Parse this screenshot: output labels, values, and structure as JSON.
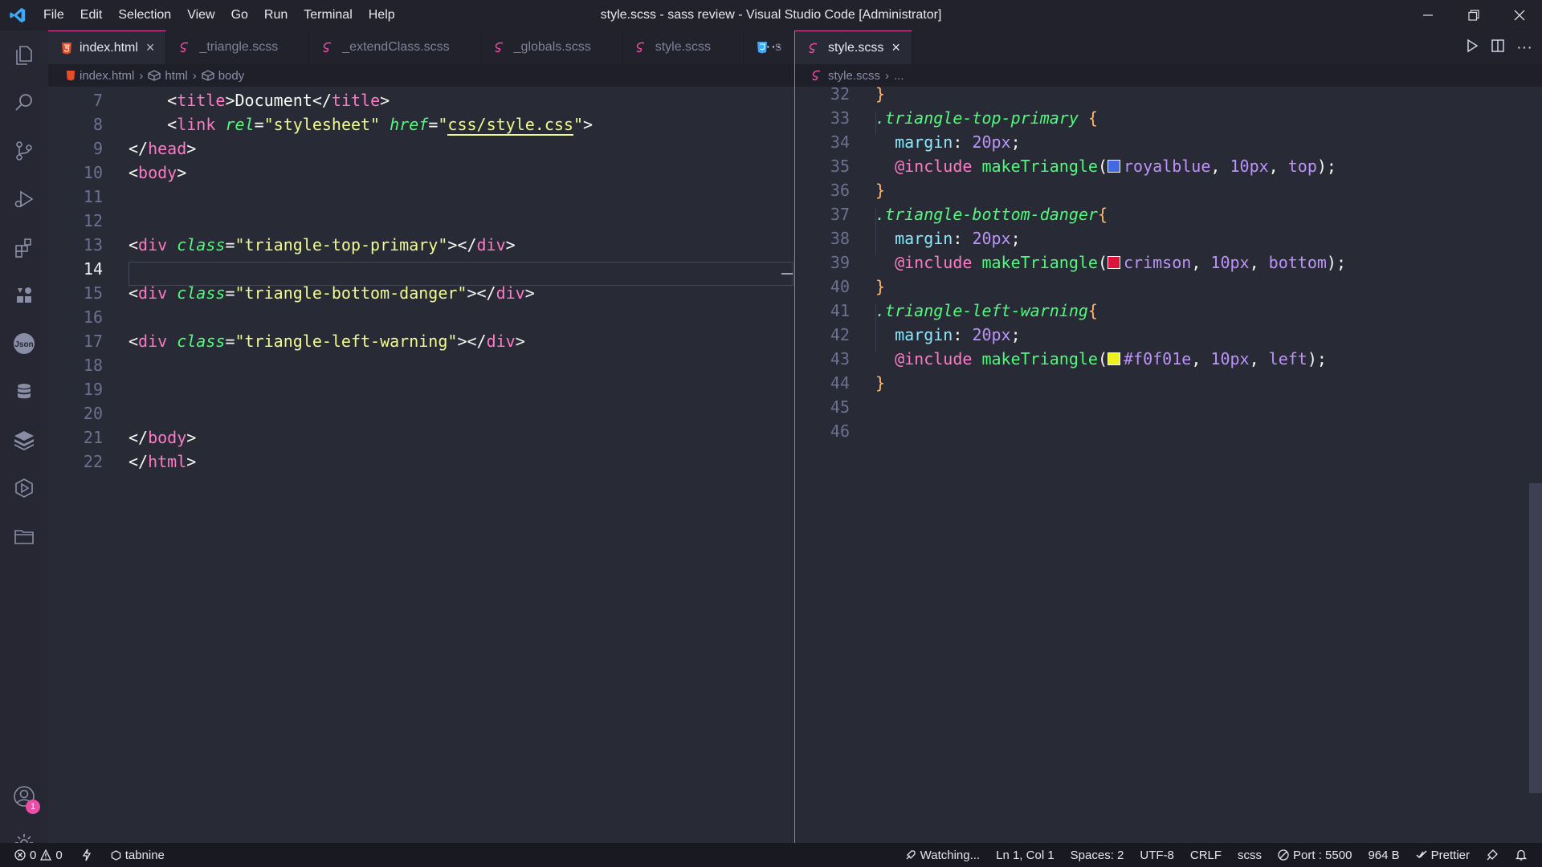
{
  "window": {
    "title": "style.scss - sass review - Visual Studio Code [Administrator]",
    "menu": [
      "File",
      "Edit",
      "Selection",
      "View",
      "Go",
      "Run",
      "Terminal",
      "Help"
    ]
  },
  "colors": {
    "accent": "#e84fa4",
    "background": "#282a36",
    "statusbar": "#191a21"
  },
  "activity_bar": {
    "icons": [
      "explorer-icon",
      "search-icon",
      "source-control-icon",
      "run-debug-icon",
      "extensions-icon",
      "puzzle-icon",
      "json-icon",
      "database-icon",
      "layers-icon",
      "play-outline-icon",
      "folder-icon",
      "account-icon",
      "settings-gear-icon"
    ],
    "account_badge": "1"
  },
  "left_group": {
    "tabs": [
      {
        "label": "index.html",
        "icon": "html-file-icon",
        "active": true
      },
      {
        "label": "_triangle.scss",
        "icon": "sass-file-icon"
      },
      {
        "label": "_extendClass.scss",
        "icon": "sass-file-icon"
      },
      {
        "label": "_globals.scss",
        "icon": "sass-file-icon"
      },
      {
        "label": "style.scss",
        "icon": "sass-file-icon"
      },
      {
        "label": "s",
        "icon": "css-file-icon"
      }
    ],
    "more": "···",
    "breadcrumb": [
      "index.html",
      "html",
      "body"
    ],
    "lines": [
      {
        "n": "7",
        "tokens": [
          [
            "t-punc",
            "    <"
          ],
          [
            "t-tag",
            "title"
          ],
          [
            "t-punc",
            ">"
          ],
          [
            "t-txt",
            "Document"
          ],
          [
            "t-punc",
            "</"
          ],
          [
            "t-tag",
            "title"
          ],
          [
            "t-punc",
            ">"
          ]
        ]
      },
      {
        "n": "8",
        "tokens": [
          [
            "t-punc",
            "    <"
          ],
          [
            "t-tag",
            "link"
          ],
          [
            "t-txt",
            " "
          ],
          [
            "t-attr",
            "rel"
          ],
          [
            "t-punc",
            "="
          ],
          [
            "t-str",
            "\"stylesheet\""
          ],
          [
            "t-txt",
            " "
          ],
          [
            "t-attr",
            "href"
          ],
          [
            "t-punc",
            "="
          ],
          [
            "t-str",
            "\""
          ],
          [
            "t-str link-u",
            "css/style.css"
          ],
          [
            "t-str",
            "\""
          ],
          [
            "t-punc",
            ">"
          ]
        ]
      },
      {
        "n": "9",
        "tokens": [
          [
            "t-punc",
            "</"
          ],
          [
            "t-tag",
            "head"
          ],
          [
            "t-punc",
            ">"
          ]
        ]
      },
      {
        "n": "10",
        "tokens": [
          [
            "t-punc",
            "<"
          ],
          [
            "t-tag",
            "body"
          ],
          [
            "t-punc",
            ">"
          ]
        ]
      },
      {
        "n": "11",
        "tokens": []
      },
      {
        "n": "12",
        "tokens": []
      },
      {
        "n": "13",
        "tokens": [
          [
            "t-punc",
            "<"
          ],
          [
            "t-tag",
            "div"
          ],
          [
            "t-txt",
            " "
          ],
          [
            "t-attr",
            "class"
          ],
          [
            "t-punc",
            "="
          ],
          [
            "t-str",
            "\"triangle-top-primary\""
          ],
          [
            "t-punc",
            "></"
          ],
          [
            "t-tag",
            "div"
          ],
          [
            "t-punc",
            ">"
          ]
        ]
      },
      {
        "n": "14",
        "tokens": [],
        "current": true
      },
      {
        "n": "15",
        "tokens": [
          [
            "t-punc",
            "<"
          ],
          [
            "t-tag",
            "div"
          ],
          [
            "t-txt",
            " "
          ],
          [
            "t-attr",
            "class"
          ],
          [
            "t-punc",
            "="
          ],
          [
            "t-str",
            "\"triangle-bottom-danger\""
          ],
          [
            "t-punc",
            "></"
          ],
          [
            "t-tag",
            "div"
          ],
          [
            "t-punc",
            ">"
          ]
        ]
      },
      {
        "n": "16",
        "tokens": []
      },
      {
        "n": "17",
        "tokens": [
          [
            "t-punc",
            "<"
          ],
          [
            "t-tag",
            "div"
          ],
          [
            "t-txt",
            " "
          ],
          [
            "t-attr",
            "class"
          ],
          [
            "t-punc",
            "="
          ],
          [
            "t-str",
            "\"triangle-left-warning\""
          ],
          [
            "t-punc",
            "></"
          ],
          [
            "t-tag",
            "div"
          ],
          [
            "t-punc",
            ">"
          ]
        ]
      },
      {
        "n": "18",
        "tokens": []
      },
      {
        "n": "19",
        "tokens": []
      },
      {
        "n": "20",
        "tokens": []
      },
      {
        "n": "21",
        "tokens": [
          [
            "t-punc",
            "</"
          ],
          [
            "t-tag",
            "body"
          ],
          [
            "t-punc",
            ">"
          ]
        ]
      },
      {
        "n": "22",
        "tokens": [
          [
            "t-punc",
            "</"
          ],
          [
            "t-tag",
            "html"
          ],
          [
            "t-punc",
            ">"
          ]
        ]
      }
    ]
  },
  "right_group": {
    "tab": {
      "label": "style.scss",
      "icon": "sass-file-icon",
      "close": "×"
    },
    "breadcrumb": [
      "style.scss",
      "..."
    ],
    "lines": [
      {
        "n": "32",
        "tokens": [
          [
            "t-brace",
            "}"
          ]
        ]
      },
      {
        "n": "33",
        "tokens": [
          [
            "t-sel",
            ".triangle-top-primary"
          ],
          [
            "t-txt",
            " "
          ],
          [
            "t-brace",
            "{"
          ]
        ]
      },
      {
        "n": "34",
        "tokens": [
          [
            "t-txt",
            "  "
          ],
          [
            "t-prop",
            "margin"
          ],
          [
            "t-txt",
            ": "
          ],
          [
            "t-num",
            "20px"
          ],
          [
            "t-txt",
            ";"
          ]
        ]
      },
      {
        "n": "35",
        "tokens": [
          [
            "t-txt",
            "  "
          ],
          [
            "t-kw",
            "@include"
          ],
          [
            "t-txt",
            " "
          ],
          [
            "t-fn",
            "makeTriangle"
          ],
          [
            "t-txt",
            "("
          ],
          [
            "swatch",
            "#4169e1"
          ],
          [
            "t-val",
            "royalblue"
          ],
          [
            "t-txt",
            ", "
          ],
          [
            "t-num",
            "10px"
          ],
          [
            "t-txt",
            ", "
          ],
          [
            "t-val",
            "top"
          ],
          [
            "t-txt",
            ");"
          ]
        ]
      },
      {
        "n": "36",
        "tokens": [
          [
            "t-brace",
            "}"
          ]
        ]
      },
      {
        "n": "37",
        "tokens": [
          [
            "t-sel",
            ".triangle-bottom-danger"
          ],
          [
            "t-brace",
            "{"
          ]
        ]
      },
      {
        "n": "38",
        "tokens": [
          [
            "t-txt",
            "  "
          ],
          [
            "t-prop",
            "margin"
          ],
          [
            "t-txt",
            ": "
          ],
          [
            "t-num",
            "20px"
          ],
          [
            "t-txt",
            ";"
          ]
        ]
      },
      {
        "n": "39",
        "tokens": [
          [
            "t-txt",
            "  "
          ],
          [
            "t-kw",
            "@include"
          ],
          [
            "t-txt",
            " "
          ],
          [
            "t-fn",
            "makeTriangle"
          ],
          [
            "t-txt",
            "("
          ],
          [
            "swatch",
            "#dc143c"
          ],
          [
            "t-val",
            "crimson"
          ],
          [
            "t-txt",
            ", "
          ],
          [
            "t-num",
            "10px"
          ],
          [
            "t-txt",
            ", "
          ],
          [
            "t-val",
            "bottom"
          ],
          [
            "t-txt",
            ");"
          ]
        ]
      },
      {
        "n": "40",
        "tokens": [
          [
            "t-brace",
            "}"
          ]
        ]
      },
      {
        "n": "41",
        "tokens": [
          [
            "t-sel",
            ".triangle-left-warning"
          ],
          [
            "t-brace",
            "{"
          ]
        ]
      },
      {
        "n": "42",
        "tokens": [
          [
            "t-txt",
            "  "
          ],
          [
            "t-prop",
            "margin"
          ],
          [
            "t-txt",
            ": "
          ],
          [
            "t-num",
            "20px"
          ],
          [
            "t-txt",
            ";"
          ]
        ]
      },
      {
        "n": "43",
        "tokens": [
          [
            "t-txt",
            "  "
          ],
          [
            "t-kw",
            "@include"
          ],
          [
            "t-txt",
            " "
          ],
          [
            "t-fn",
            "makeTriangle"
          ],
          [
            "t-txt",
            "("
          ],
          [
            "swatch",
            "#f0f01e"
          ],
          [
            "t-val",
            "#f0f01e"
          ],
          [
            "t-txt",
            ", "
          ],
          [
            "t-num",
            "10px"
          ],
          [
            "t-txt",
            ", "
          ],
          [
            "t-val",
            "left"
          ],
          [
            "t-txt",
            ");"
          ]
        ]
      },
      {
        "n": "44",
        "tokens": [
          [
            "t-brace",
            "}"
          ]
        ]
      },
      {
        "n": "45",
        "tokens": []
      },
      {
        "n": "46",
        "tokens": []
      }
    ]
  },
  "status_bar": {
    "errors": "0",
    "warnings": "0",
    "tabnine": "tabnine",
    "watching": "Watching...",
    "position": "Ln 1, Col 1",
    "spaces": "Spaces: 2",
    "encoding": "UTF-8",
    "eol": "CRLF",
    "language": "scss",
    "port": "Port : 5500",
    "size": "964 B",
    "prettier": "Prettier"
  }
}
